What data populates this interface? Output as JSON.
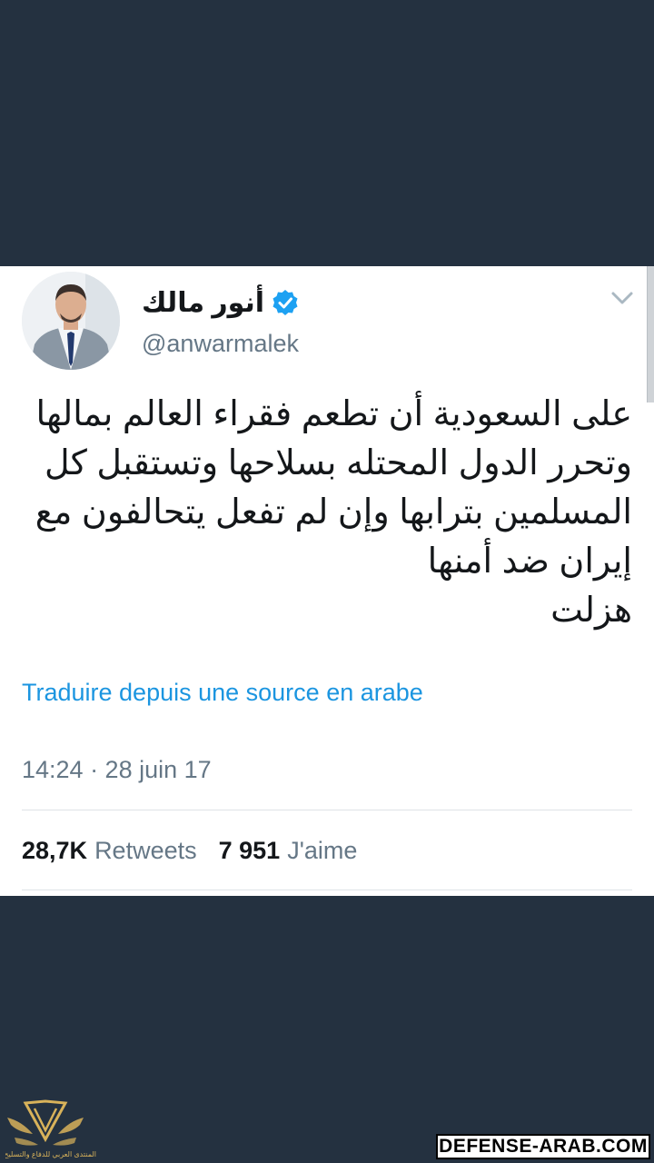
{
  "tweet": {
    "display_name": "أنور مالك",
    "verified": true,
    "handle": "@anwarmalek",
    "text": "على السعودية أن تطعم فقراء العالم بمالها\nوتحرر الدول المحتله بسلاحها وتستقبل كل\nالمسلمين بترابها وإن لم تفعل يتحالفون مع\nإيران ضد أمنها\nهزلت",
    "translate_link": "Traduire depuis une source en arabe",
    "timestamp": "14:24 · 28 juin 17",
    "retweets_count": "28,7K",
    "retweets_label": "Retweets",
    "likes_count": "7 951",
    "likes_label": "J'aime"
  },
  "watermark": {
    "site": "DEFENSE-ARAB.COM",
    "logo_caption": "المنتدى العربي للدفاع والتسليح"
  },
  "colors": {
    "background": "#243140",
    "card": "#ffffff",
    "link": "#1b95e0",
    "secondary_text": "#657786",
    "verified": "#1da1f2"
  }
}
